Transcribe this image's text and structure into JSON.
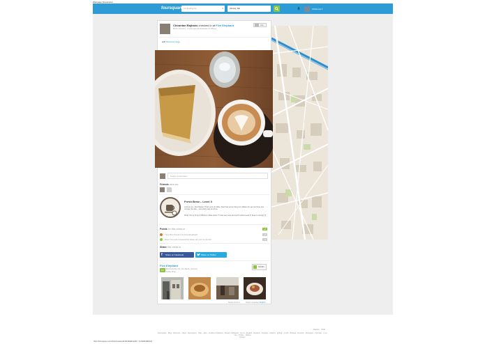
{
  "tab_title": "Webpage Screenshot",
  "topbar": {
    "logo": "foursquare",
    "search_placeholder": "I'm looking for...",
    "near_value": "Almaty, DE",
    "user_name": "Chiranrus ▾"
  },
  "checkin": {
    "user": "Chirantan Rajhans",
    "verb": "checked in at",
    "venue": "Five Elephant",
    "meta": "Berlin, Germany · 2 years ago via foursquare for iPhone",
    "like_label": "Like",
    "with_prefix": "with",
    "with_name": "Rebecca Jiggy"
  },
  "comment_placeholder": "Leave a comment...",
  "friends_title": "Friends",
  "friends_suffix": "here too",
  "badge": {
    "title": "Fresh Brew – Level 3",
    "text1": "Look at you, Java Master. That's a lot of coffee. Now that you've had your caffeine fix, get out there and conquer the day – one lovely step at a time.",
    "text2": "Wow! You've hit up 3 different coffee spots. 5 more new ones and you'll unlock Level 4! Keep it moving! ☕"
  },
  "points": {
    "title": "Points",
    "title_suffix": "for this check-in",
    "total": "+5",
    "items": [
      {
        "text": "Your first check-in at Five Elephant!",
        "value": "+3",
        "color": "#e8712a"
      },
      {
        "text": "Woo! You just crossed this place off your to-do list!",
        "value": "+2",
        "color": "#8cc63f"
      }
    ]
  },
  "share": {
    "title": "Share",
    "title_suffix": "this check-in",
    "facebook": "Share on Facebook",
    "twitter": "Share on Twitter"
  },
  "venue": {
    "name": "Five Elephant",
    "address": "Reichenberger Str. 101, Berlin, Germany",
    "category": "Coffee Shop",
    "rating": "9.0",
    "saved": "SAVED"
  },
  "card_footer": {
    "delete": "Delete check-in",
    "language": "Select Language:",
    "lang_value": "English"
  },
  "footer": {
    "map_credit": "Mapbox · OSM",
    "links": "Foursquare · Blog · Business · Cities · Developers · Help · Jobs · Cookies (Updated) · Privacy (Updated) · Terms · English · Español · Français · Italiano · 日本語 · 한국어 · Bahasa · Deutsch · Português · Русский · ภาษาไทย · Türkçe · Filipino",
    "links2": "Privacy"
  },
  "status_url": "https://foursquare.com/chiranrus/checkin/5149a981e4b0...?s=9e8bd3fb4fa4",
  "colors": {
    "topbar": "#2d9cd6",
    "accent_green": "#8cc63f",
    "facebook": "#3b5998",
    "twitter": "#2aa9e0"
  }
}
